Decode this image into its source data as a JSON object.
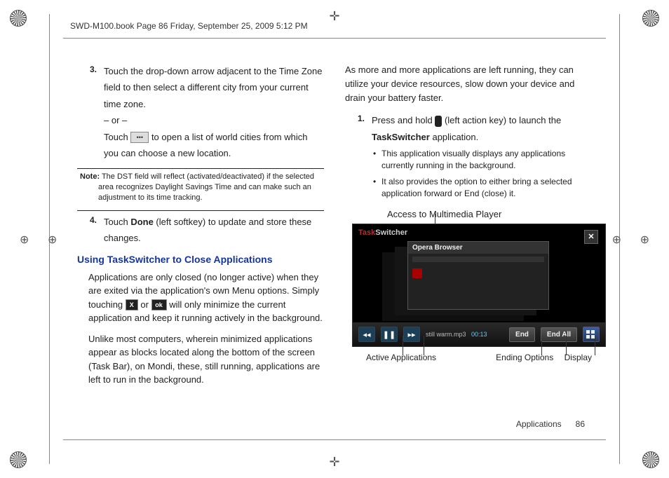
{
  "header": "SWD-M100.book  Page 86  Friday, September 25, 2009  5:12 PM",
  "footer": {
    "section": "Applications",
    "page": "86"
  },
  "left": {
    "step3_a": "Touch the drop-down arrow adjacent to the Time Zone field to then select a different city from your current time zone.",
    "or": "– or –",
    "step3_b_pre": "Touch ",
    "step3_b_post": " to open a list of world cities from which you can choose a new location.",
    "note_label": "Note:",
    "note_body": " The DST field will reflect (activated/deactivated) if the selected area recognizes Daylight Savings Time and can make such an adjustment to its time tracking.",
    "step4_pre": "Touch ",
    "step4_bold": "Done",
    "step4_post": " (left softkey) to update and store these changes.",
    "h3": "Using TaskSwitcher to Close Applications",
    "para1_a": "Applications are only closed (no longer active) when they are exited via the application's own Menu options. Simply touching ",
    "para1_b": " or ",
    "para1_c": " will only minimize the current application and keep it running actively in the background.",
    "para2": "Unlike most computers, wherein minimized applications appear as blocks located along the bottom of the screen (Task Bar), on Mondi, these, still running, applications are left to run in the background."
  },
  "right": {
    "intro": "As more and more applications are left running, they can utilize your device resources, slow down your device and drain your battery faster.",
    "step1_a": "Press and hold ",
    "step1_b": " (left action key) to launch the ",
    "step1_bold": "TaskSwitcher",
    "step1_c": " application.",
    "b1": "This application visually displays any applications currently running in the background.",
    "b2": "It also provides the option to either bring a selected application forward or End (close) it.",
    "cap_top": "Access to Multimedia Player",
    "cap_active": "Active Applications",
    "cap_ending": "Ending Options",
    "cap_display": "Display",
    "shot": {
      "title_task": "Task",
      "title_switcher": "Switcher",
      "win_title": "Opera Browser",
      "song": "still warm.mp3",
      "time": "00:13",
      "end": "End",
      "endall": "End All"
    }
  }
}
